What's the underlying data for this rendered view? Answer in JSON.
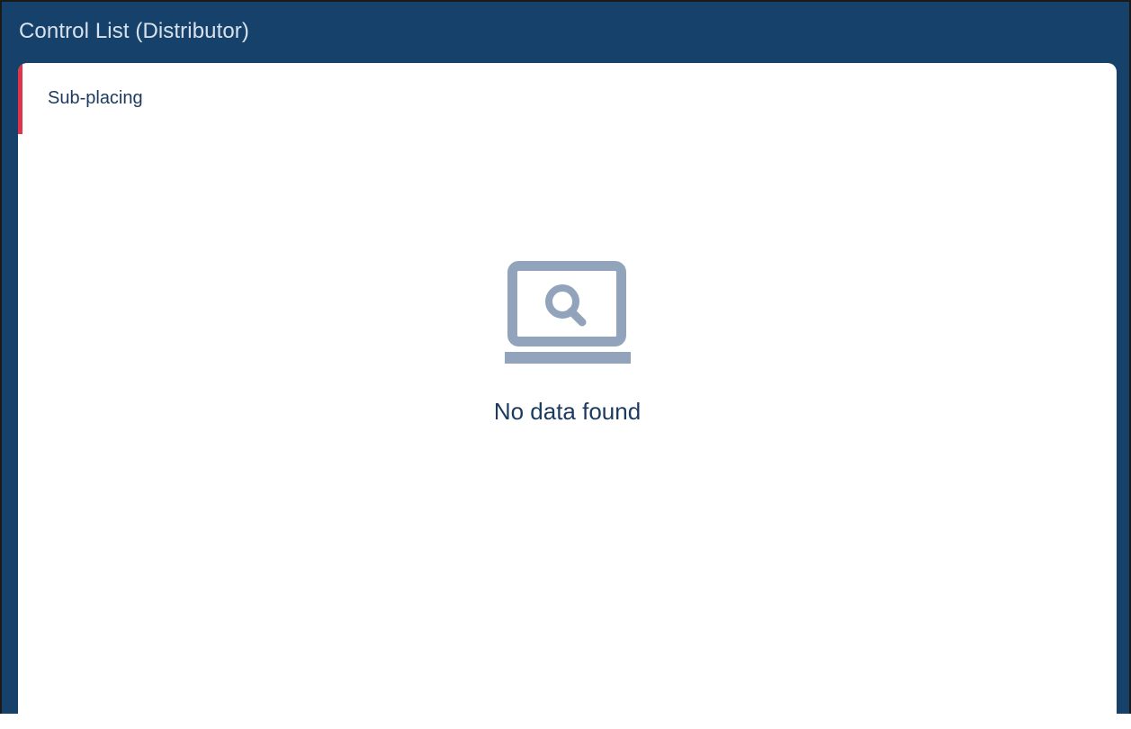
{
  "header": {
    "title": "Control List (Distributor)"
  },
  "tabs": [
    {
      "label": "Sub-placing",
      "active": true
    }
  ],
  "empty_state": {
    "icon": "laptop-search-icon",
    "message": "No data found"
  },
  "colors": {
    "header_bg": "#15416b",
    "active_tab_accent": "#e0344a",
    "icon_color": "#91a4bb",
    "text_color": "#1c3a5e"
  }
}
